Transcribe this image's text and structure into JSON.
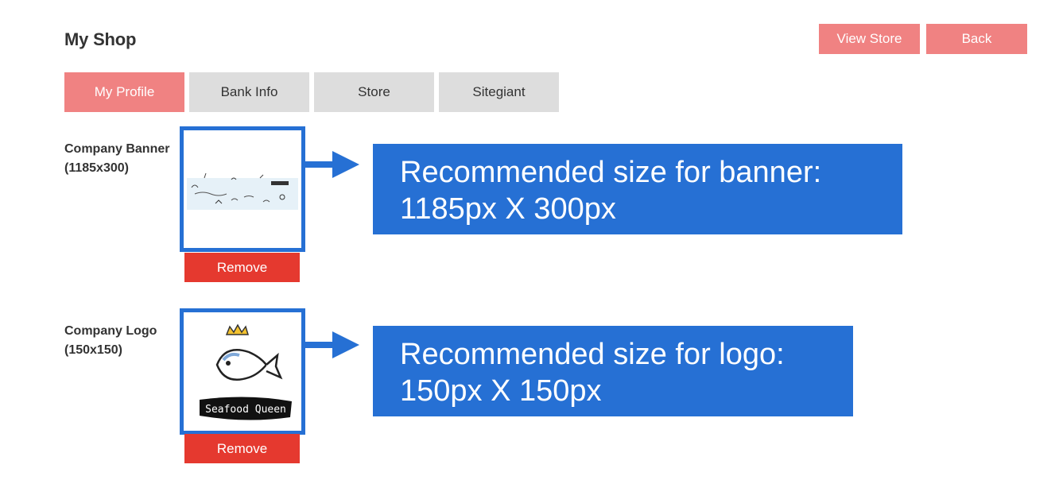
{
  "header": {
    "title": "My Shop",
    "view_store_label": "View Store",
    "back_label": "Back"
  },
  "tabs": [
    {
      "label": "My Profile",
      "active": true
    },
    {
      "label": "Bank Info",
      "active": false
    },
    {
      "label": "Store",
      "active": false
    },
    {
      "label": "Sitegiant",
      "active": false
    }
  ],
  "banner": {
    "label": "Company Banner",
    "size": "(1185x300)",
    "remove_label": "Remove",
    "callout_line1": "Recommended size for banner:",
    "callout_line2": "1185px X 300px"
  },
  "logo": {
    "label": "Company Logo",
    "size": "(150x150)",
    "remove_label": "Remove",
    "callout_line1": "Recommended size for logo:",
    "callout_line2": "150px X 150px",
    "logo_text": "Seafood Queen"
  },
  "colors": {
    "accent": "#f08282",
    "remove": "#e5392f",
    "highlight": "#2670d4",
    "tab_inactive": "#dddddd"
  }
}
